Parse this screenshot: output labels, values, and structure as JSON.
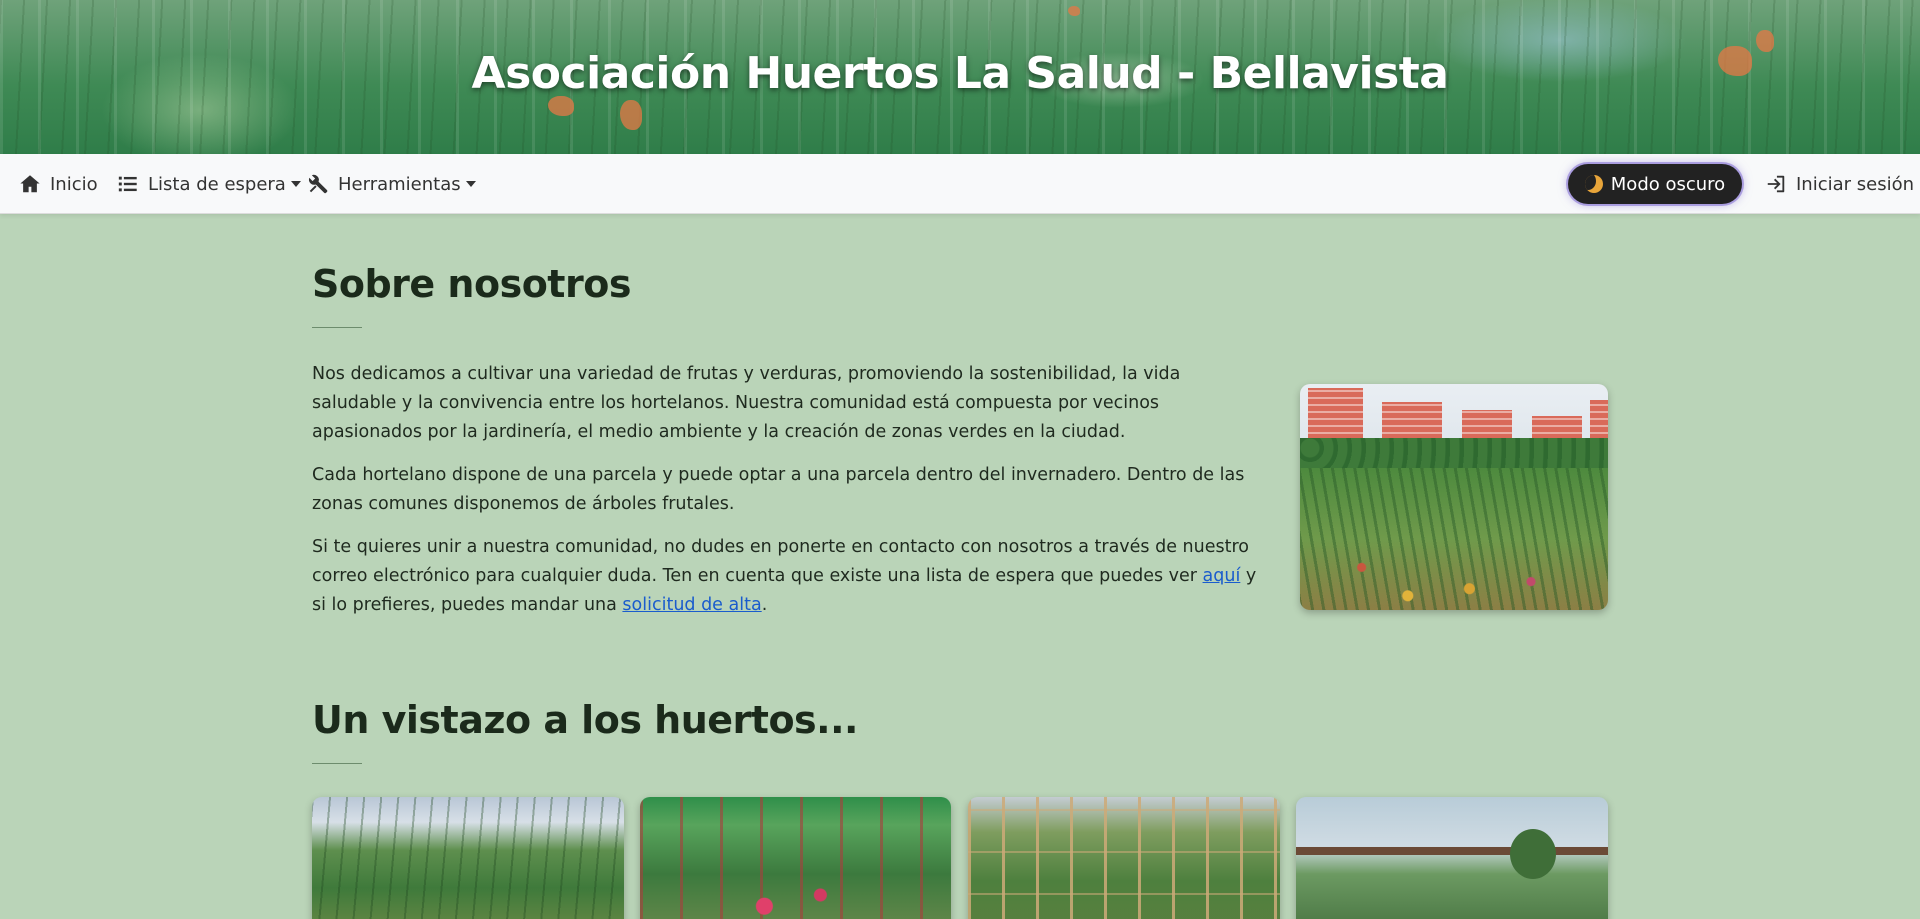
{
  "header": {
    "title": "Asociación Huertos La Salud - Bellavista"
  },
  "navbar": {
    "items": [
      {
        "label": "Inicio",
        "icon": "home-icon"
      },
      {
        "label": "Lista de espera",
        "icon": "list-icon",
        "dropdown": true
      },
      {
        "label": "Herramientas",
        "icon": "tools-icon",
        "dropdown": true
      }
    ],
    "dark_mode_label": "Modo oscuro",
    "login_label": "Iniciar sesión"
  },
  "about": {
    "title": "Sobre nosotros",
    "p1": "Nos dedicamos a cultivar una variedad de frutas y verduras, promoviendo la sostenibilidad, la vida saludable y la convivencia entre los hortelanos. Nuestra comunidad está compuesta por vecinos apasionados por la jardinería, el medio ambiente y la creación de zonas verdes en la ciudad.",
    "p2": "Cada hortelano dispone de una parcela y puede optar a una parcela dentro del invernadero. Dentro de las zonas comunes disponemos de árboles frutales.",
    "p3_before": "Si te quieres unir a nuestra comunidad, no dudes en ponerte en contacto con nosotros a través de nuestro correo electrónico para cualquier duda. Ten en cuenta que existe una lista de espera que puedes ver ",
    "p3_link1": "aquí",
    "p3_middle": " y si lo prefieres, puedes mandar una ",
    "p3_link2": "solicitud de alta",
    "p3_end": "."
  },
  "gallery": {
    "title": "Un vistazo a los huertos..."
  },
  "colors": {
    "background": "#bad4b8",
    "link": "#1a5ccd",
    "navbar": "#f8f9fa",
    "dark_button": "#222222"
  }
}
